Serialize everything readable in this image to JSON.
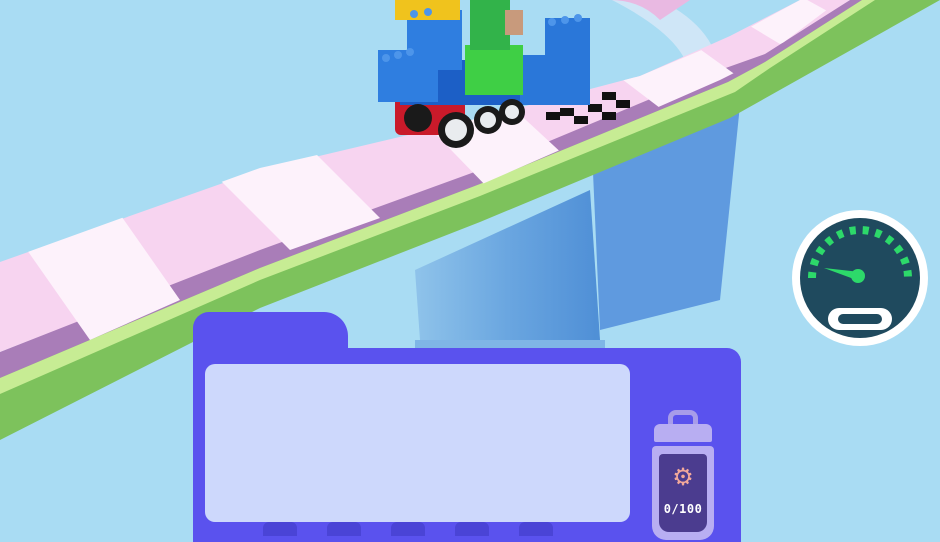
{
  "hud": {
    "bin_count": "0/100",
    "gear_icon": "gear-icon",
    "speedometer_icon": "speedometer-icon"
  },
  "colors": {
    "sky": "#a9dcf3",
    "panel": "#5a52ee",
    "track_stripe_pink": "#f7d4f0",
    "track_stripe_white": "#fdf2fb",
    "track_edge_green": "#7dc25c",
    "speed_gauge": "#2dd96a"
  }
}
